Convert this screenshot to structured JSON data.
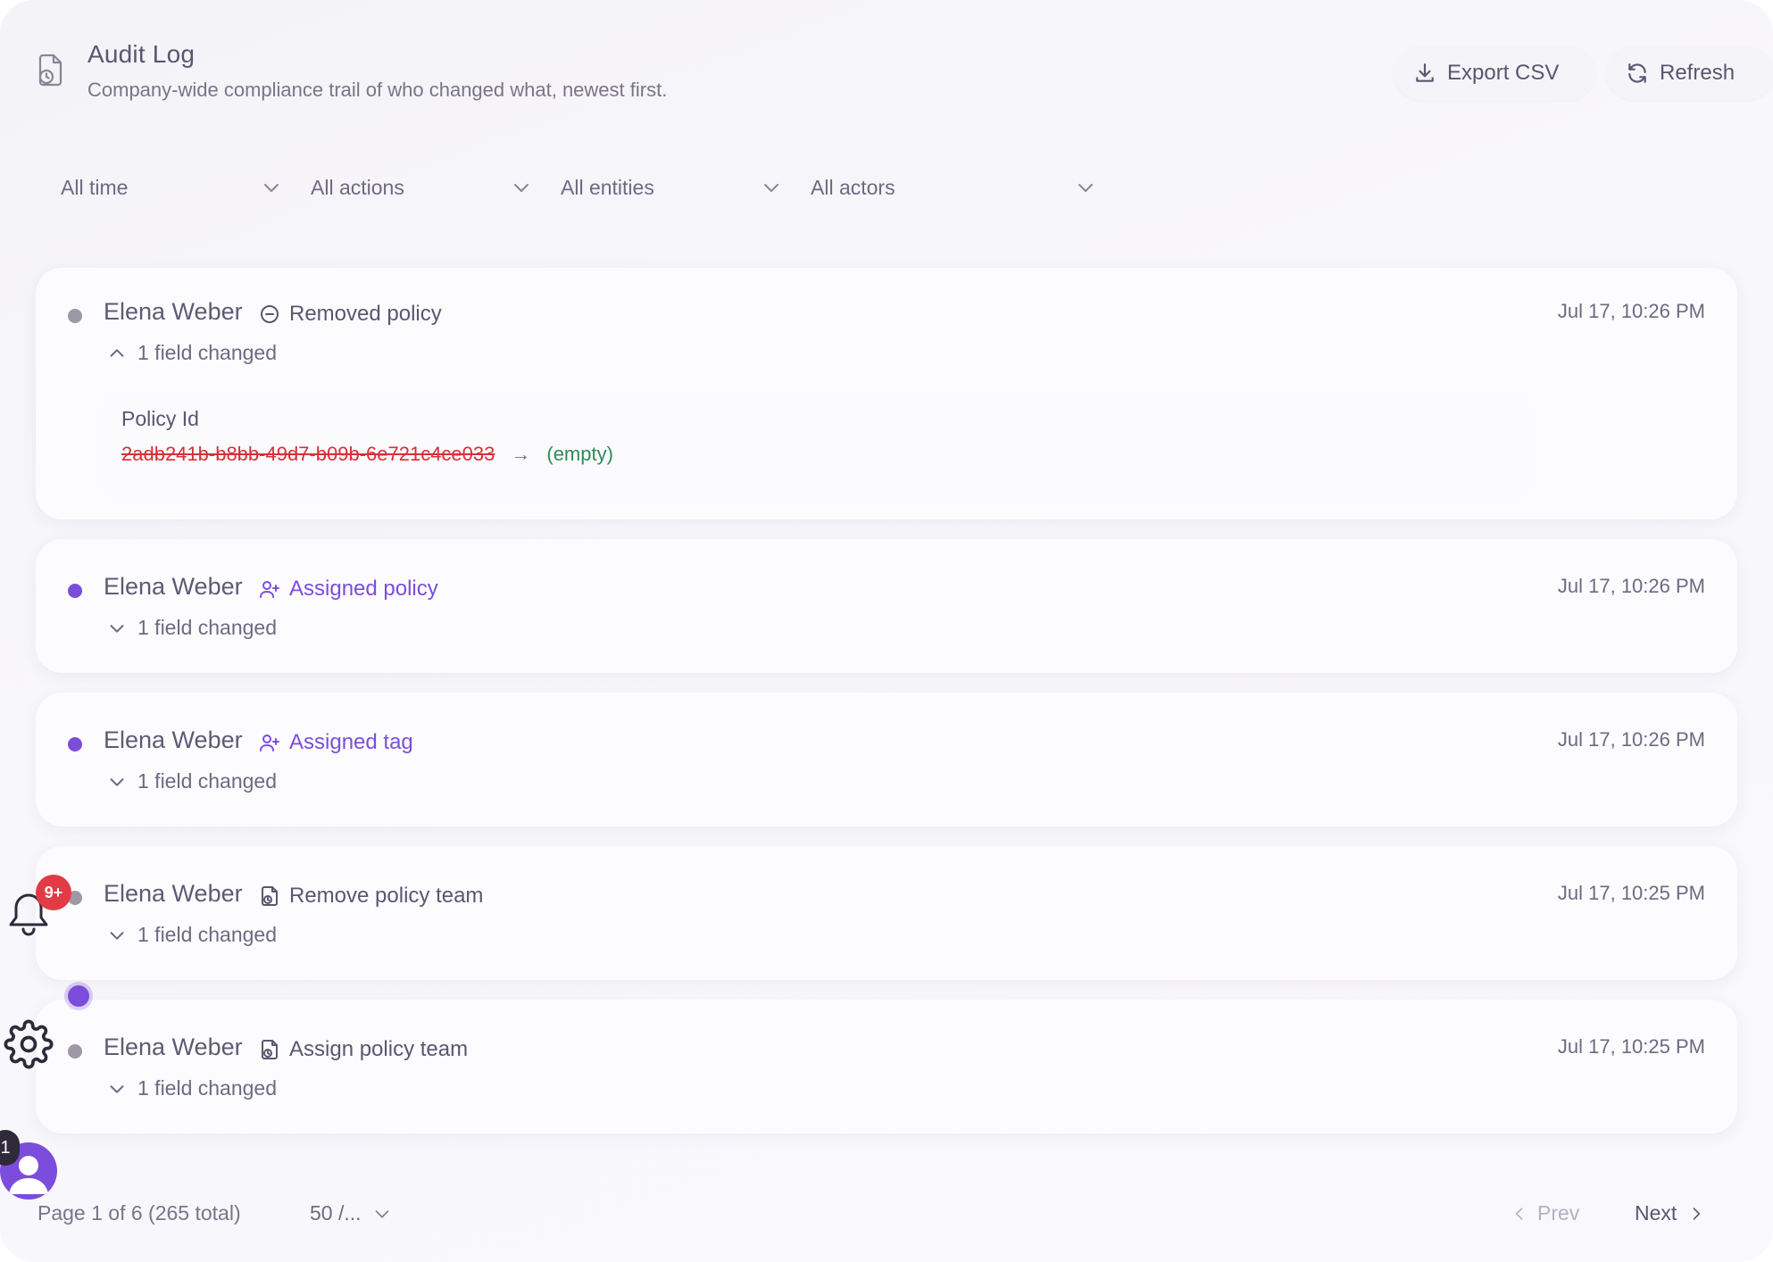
{
  "header": {
    "title": "Audit Log",
    "subtitle": "Company-wide compliance trail of who changed what, newest first.",
    "export_label": "Export CSV",
    "refresh_label": "Refresh"
  },
  "filters": {
    "time": "All time",
    "actions": "All actions",
    "entities": "All entities",
    "actors": "All actors"
  },
  "entries": [
    {
      "actor": "Elena Weber",
      "action": "Removed policy",
      "action_icon": "minus-circle-icon",
      "time": "Jul 17, 10:26 PM",
      "toggle": "1 field changed",
      "expanded": true,
      "field_label": "Policy Id",
      "old_value": "2adb241b-b8bb-49d7-b09b-6e721c4ce033",
      "arrow": "→",
      "new_value": "(empty)"
    },
    {
      "actor": "Elena Weber",
      "action": "Assigned policy",
      "action_icon": "user-plus-icon",
      "time": "Jul 17, 10:26 PM",
      "toggle": "1 field changed"
    },
    {
      "actor": "Elena Weber",
      "action": "Assigned tag",
      "action_icon": "user-plus-icon",
      "time": "Jul 17, 10:26 PM",
      "toggle": "1 field changed"
    },
    {
      "actor": "Elena Weber",
      "action": "Remove policy team",
      "action_icon": "document-clock-icon",
      "time": "Jul 17, 10:25 PM",
      "toggle": "1 field changed"
    },
    {
      "actor": "Elena Weber",
      "action": "Assign policy team",
      "action_icon": "document-clock-icon",
      "time": "Jul 17, 10:25 PM",
      "toggle": "1 field changed"
    }
  ],
  "pagination": {
    "info": "Page 1 of 6 (265 total)",
    "page_size": "50 /...",
    "prev": "Prev",
    "next": "Next"
  },
  "floating": {
    "notification_badge": "9+",
    "avatar_badge": "1"
  },
  "colors": {
    "accent_purple": "#7c4ddc",
    "removed_red": "#d6303a",
    "added_green": "#2e8b57",
    "badge_red": "#e23b45"
  }
}
